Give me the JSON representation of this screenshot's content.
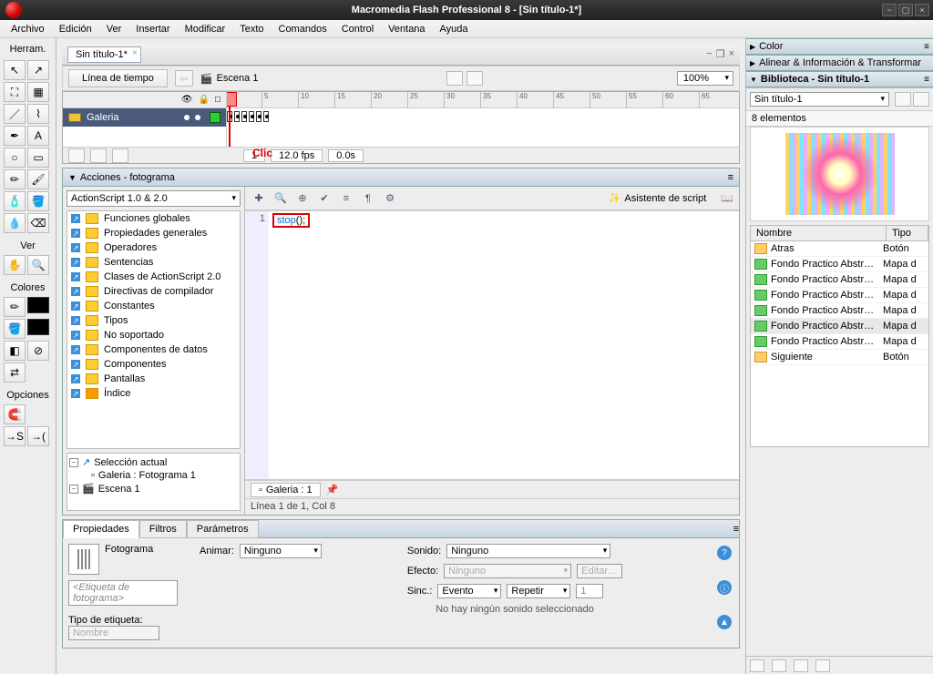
{
  "titlebar": {
    "title": "Macromedia Flash Professional 8 - [Sin título-1*]"
  },
  "menu": [
    "Archivo",
    "Edición",
    "Ver",
    "Insertar",
    "Modificar",
    "Texto",
    "Comandos",
    "Control",
    "Ventana",
    "Ayuda"
  ],
  "tools": {
    "title": "Herram.",
    "view_label": "Ver",
    "colors_label": "Colores",
    "options_label": "Opciones"
  },
  "doc": {
    "tab": "Sin título-1*",
    "timeline_btn": "Línea de tiempo",
    "scene": "Escena 1",
    "zoom": "100%"
  },
  "timeline": {
    "layer": "Galeria",
    "clic": "Clic",
    "fps": "12.0 fps",
    "time": "0.0s",
    "frame": "1"
  },
  "actions": {
    "title": "Acciones - fotograma",
    "as_version": "ActionScript 1.0 & 2.0",
    "tree": [
      "Funciones globales",
      "Propiedades generales",
      "Operadores",
      "Sentencias",
      "Clases de ActionScript 2.0",
      "Directivas de compilador",
      "Constantes",
      "Tipos",
      "No soportado",
      "Componentes de datos",
      "Componentes",
      "Pantallas",
      "Índice"
    ],
    "selection_header": "Selección actual",
    "selection_item": "Galeria : Fotograma 1",
    "scene_item": "Escena 1",
    "code_line1": "stop();",
    "script_tab": "Galeria : 1",
    "status": "Línea 1 de 1, Col 8",
    "assist": "Asistente de script"
  },
  "props": {
    "tabs": [
      "Propiedades",
      "Filtros",
      "Parámetros"
    ],
    "frame_label": "Fotograma",
    "frame_placeholder": "<Etiqueta de fotograma>",
    "label_type": "Tipo de etiqueta:",
    "label_type_value": "Nombre",
    "animar": "Animar:",
    "animar_val": "Ninguno",
    "sonido": "Sonido:",
    "sonido_val": "Ninguno",
    "efecto": "Efecto:",
    "efecto_val": "Ninguno",
    "editar": "Editar…",
    "sinc": "Sinc.:",
    "sinc_val": "Evento",
    "repetir": "Repetir",
    "repetir_n": "1",
    "no_sound": "No hay ningún sonido seleccionado"
  },
  "right": {
    "color": "Color",
    "align": "Alinear & Información & Transformar",
    "library": "Biblioteca - Sin título-1",
    "lib_doc": "Sin título-1",
    "lib_count": "8 elementos",
    "col_name": "Nombre",
    "col_type": "Tipo",
    "items": [
      {
        "name": "Atras",
        "type": "Botón",
        "kind": "btn"
      },
      {
        "name": "Fondo Practico Abstracto",
        "type": "Mapa d",
        "kind": "bmp"
      },
      {
        "name": "Fondo Practico Abstrac...",
        "type": "Mapa d",
        "kind": "bmp"
      },
      {
        "name": "Fondo Practico Abstrac...",
        "type": "Mapa d",
        "kind": "bmp"
      },
      {
        "name": "Fondo Practico Abstrac...",
        "type": "Mapa d",
        "kind": "bmp"
      },
      {
        "name": "Fondo Practico Abstrac...",
        "type": "Mapa d",
        "kind": "bmp",
        "sel": true
      },
      {
        "name": "Fondo Practico Abstrac...",
        "type": "Mapa d",
        "kind": "bmp"
      },
      {
        "name": "Siguiente",
        "type": "Botón",
        "kind": "btn"
      }
    ]
  }
}
